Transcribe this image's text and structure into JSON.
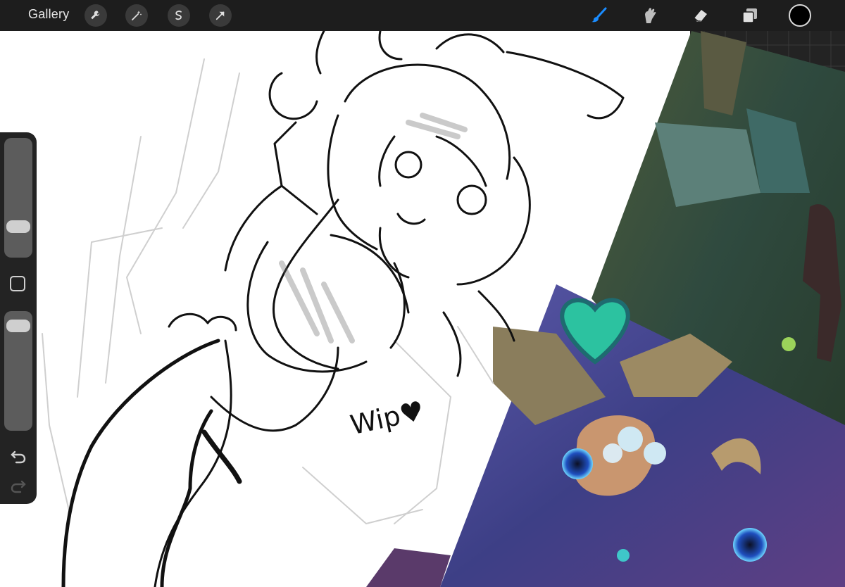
{
  "toolbar": {
    "gallery_label": "Gallery",
    "left_tools": [
      "wrench-icon",
      "magic-wand-icon",
      "selection-icon",
      "transform-arrow-icon"
    ],
    "right_tools": [
      "brush-icon",
      "smudge-icon",
      "eraser-icon",
      "layers-icon"
    ],
    "active_tool": "brush-icon",
    "accent_color": "#1a8cff",
    "current_color": "#000000"
  },
  "sidebar": {
    "brush_size_level": 0.22,
    "opacity_level": 0.94,
    "icons": [
      "modify-square-icon",
      "undo-icon",
      "redo-icon"
    ]
  },
  "canvas": {
    "handwritten_text": "Wip♥"
  }
}
